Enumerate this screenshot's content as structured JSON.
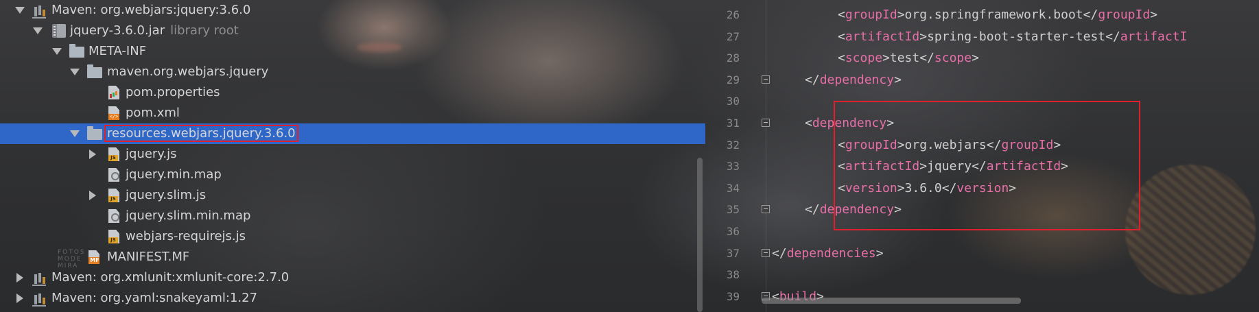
{
  "tree": {
    "rows": [
      {
        "label": "Maven: org.webjars:jquery:3.6.0"
      },
      {
        "label": "jquery-3.6.0.jar",
        "hint": "library root"
      },
      {
        "label": "META-INF"
      },
      {
        "label": "maven.org.webjars.jquery"
      },
      {
        "label": "pom.properties"
      },
      {
        "label": "pom.xml"
      },
      {
        "label": "resources.webjars.jquery.3.6.0"
      },
      {
        "label": "jquery.js"
      },
      {
        "label": "jquery.min.map"
      },
      {
        "label": "jquery.slim.js"
      },
      {
        "label": "jquery.slim.min.map"
      },
      {
        "label": "webjars-requirejs.js"
      },
      {
        "label": "MANIFEST.MF"
      },
      {
        "label": "Maven: org.xmlunit:xmlunit-core:2.7.0"
      },
      {
        "label": "Maven: org.yaml:snakeyaml:1.27"
      }
    ],
    "selected_index": 6,
    "watermark": "FOTOS\nMODE\nMIRA"
  },
  "editor": {
    "lines": [
      {
        "n": "26",
        "indent": 3,
        "open": "groupId",
        "text": "org.springframework.boot",
        "close": "groupId"
      },
      {
        "n": "27",
        "indent": 3,
        "open": "artifactId",
        "text": "spring-boot-starter-test",
        "close": "artifactI"
      },
      {
        "n": "28",
        "indent": 3,
        "open": "scope",
        "text": "test",
        "close": "scope"
      },
      {
        "n": "29",
        "indent": 2,
        "close_only": "dependency"
      },
      {
        "n": "30"
      },
      {
        "n": "31",
        "indent": 2,
        "open_only": "dependency"
      },
      {
        "n": "32",
        "indent": 3,
        "open": "groupId",
        "text": "org.webjars",
        "close": "groupId"
      },
      {
        "n": "33",
        "indent": 3,
        "open": "artifactId",
        "text": "jquery",
        "close": "artifactId"
      },
      {
        "n": "34",
        "indent": 3,
        "open": "version",
        "text": "3.6.0",
        "close": "version"
      },
      {
        "n": "35",
        "indent": 2,
        "close_only": "dependency"
      },
      {
        "n": "36"
      },
      {
        "n": "37",
        "indent": 1,
        "close_only": "dependencies"
      },
      {
        "n": "38"
      },
      {
        "n": "39",
        "indent": 1,
        "open_only": "build"
      }
    ]
  },
  "colors": {
    "selection": "#2f67c8",
    "highlight_border": "#e0202a",
    "xml_tag": "#e86ea8"
  }
}
